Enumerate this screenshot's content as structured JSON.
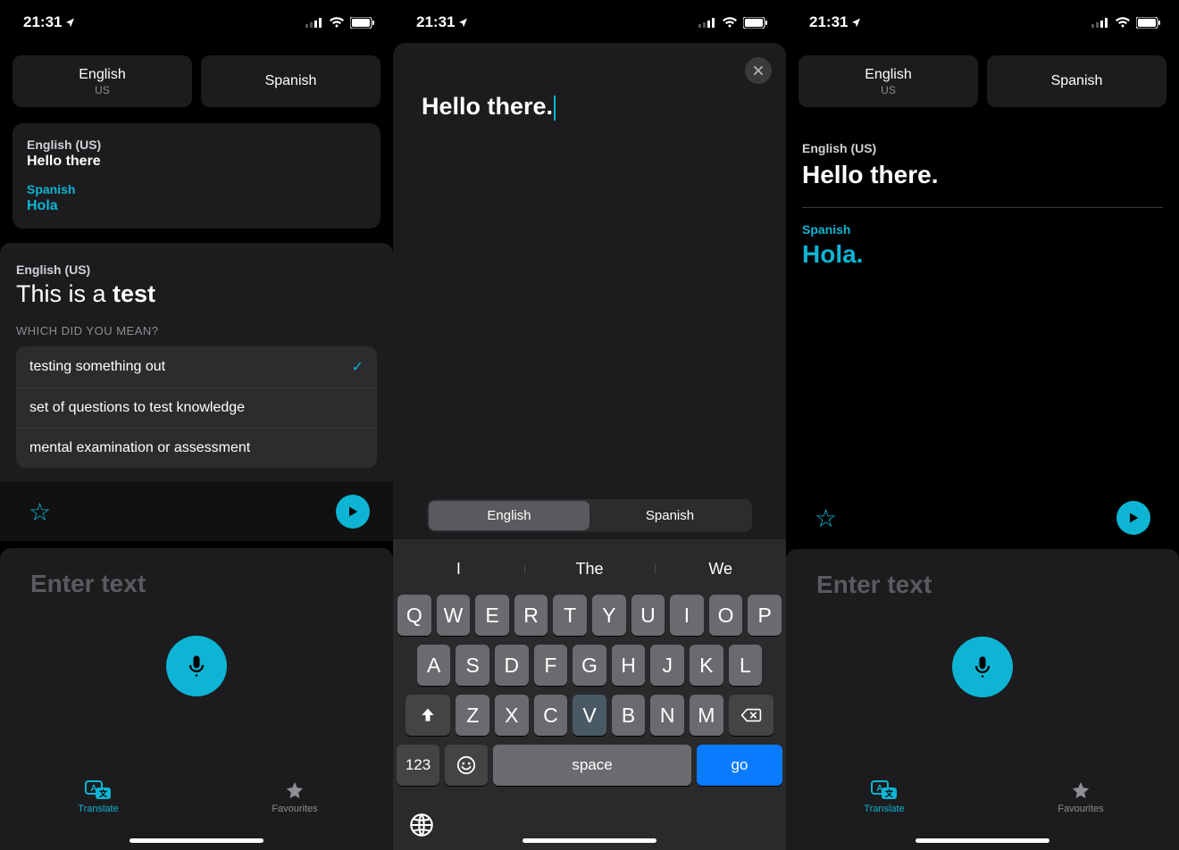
{
  "status": {
    "time": "21:31"
  },
  "langs": {
    "source": {
      "name": "English",
      "region": "US"
    },
    "target": {
      "name": "Spanish"
    }
  },
  "screen1": {
    "card": {
      "src_lang": "English (US)",
      "src_text": "Hello there",
      "tgt_lang": "Spanish",
      "tgt_text": "Hola"
    },
    "disambig": {
      "src_lang": "English (US)",
      "prefix": "This is a ",
      "word": "test",
      "which": "WHICH DID YOU MEAN?",
      "options": [
        "testing something out",
        "set of questions to test knowledge",
        "mental examination or assessment"
      ],
      "selected_index": 0
    },
    "enter_placeholder": "Enter text"
  },
  "screen2": {
    "input_text": "Hello there.",
    "segments": [
      "English",
      "Spanish"
    ],
    "selected_segment": 0,
    "suggestions": [
      "I",
      "The",
      "We"
    ],
    "keyboard": {
      "row1": [
        "Q",
        "W",
        "E",
        "R",
        "T",
        "Y",
        "U",
        "I",
        "O",
        "P"
      ],
      "row2": [
        "A",
        "S",
        "D",
        "F",
        "G",
        "H",
        "J",
        "K",
        "L"
      ],
      "row3": [
        "Z",
        "X",
        "C",
        "V",
        "B",
        "N",
        "M"
      ],
      "numbers_label": "123",
      "space_label": "space",
      "go_label": "go"
    }
  },
  "screen3": {
    "src_lang": "English (US)",
    "src_text": "Hello there.",
    "tgt_lang": "Spanish",
    "tgt_text": "Hola.",
    "enter_placeholder": "Enter text"
  },
  "tabs": {
    "translate": "Translate",
    "favourites": "Favourites"
  }
}
